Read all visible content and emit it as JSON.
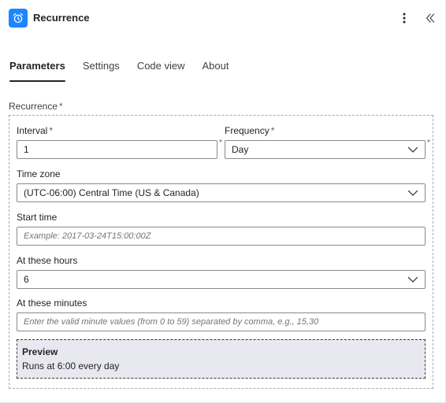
{
  "header": {
    "title": "Recurrence",
    "icon": "alarm-clock-icon",
    "accent_color": "#1f85ff"
  },
  "tabs": [
    {
      "label": "Parameters",
      "active": true
    },
    {
      "label": "Settings",
      "active": false
    },
    {
      "label": "Code view",
      "active": false
    },
    {
      "label": "About",
      "active": false
    }
  ],
  "recurrence": {
    "label": "Recurrence",
    "required_mark": "*",
    "interval": {
      "label": "Interval",
      "required_mark": "*",
      "value": "1"
    },
    "frequency": {
      "label": "Frequency",
      "required_mark": "*",
      "value": "Day"
    },
    "time_zone": {
      "label": "Time zone",
      "value": "(UTC-06:00) Central Time (US & Canada)"
    },
    "start_time": {
      "label": "Start time",
      "placeholder": "Example: 2017-03-24T15:00:00Z"
    },
    "hours": {
      "label": "At these hours",
      "value": "6"
    },
    "minutes": {
      "label": "At these minutes",
      "placeholder": "Enter the valid minute values (from 0 to 59) separated by comma, e.g., 15,30"
    },
    "preview": {
      "title": "Preview",
      "text": "Runs at 6:00 every day"
    }
  }
}
